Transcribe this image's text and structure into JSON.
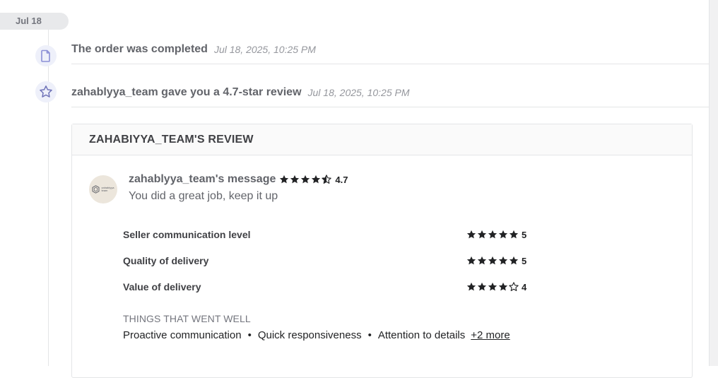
{
  "timeline": {
    "date_label": "Jul 18",
    "events": [
      {
        "icon": "document-icon",
        "title": "The order was completed",
        "time": "Jul 18, 2025, 10:25 PM"
      },
      {
        "icon": "star-outline-icon",
        "title": "zahablyya_team gave you a 4.7-star review",
        "time": "Jul 18, 2025, 10:25 PM"
      }
    ]
  },
  "review": {
    "header": "ZAHABIYYA_TEAM'S REVIEW",
    "avatar_text_1": "zahabiyya",
    "avatar_text_2": "team",
    "author_label": "zahablyya_team's message",
    "overall_rating": "4.7",
    "overall_rating_value": 4.7,
    "message": "You did a great job, keep it up",
    "ratings": [
      {
        "label": "Seller communication level",
        "value": "5",
        "stars": 5
      },
      {
        "label": "Quality of delivery",
        "value": "5",
        "stars": 5
      },
      {
        "label": "Value of delivery",
        "value": "4",
        "stars": 4
      }
    ],
    "things_title": "THINGS THAT WENT WELL",
    "things": [
      "Proactive communication",
      "Quick responsiveness",
      "Attention to details"
    ],
    "more_link": "+2 more"
  },
  "colors": {
    "icon_bg": "#eef0fa",
    "icon_fg": "#8b8fd6",
    "star_filled": "#222325"
  }
}
